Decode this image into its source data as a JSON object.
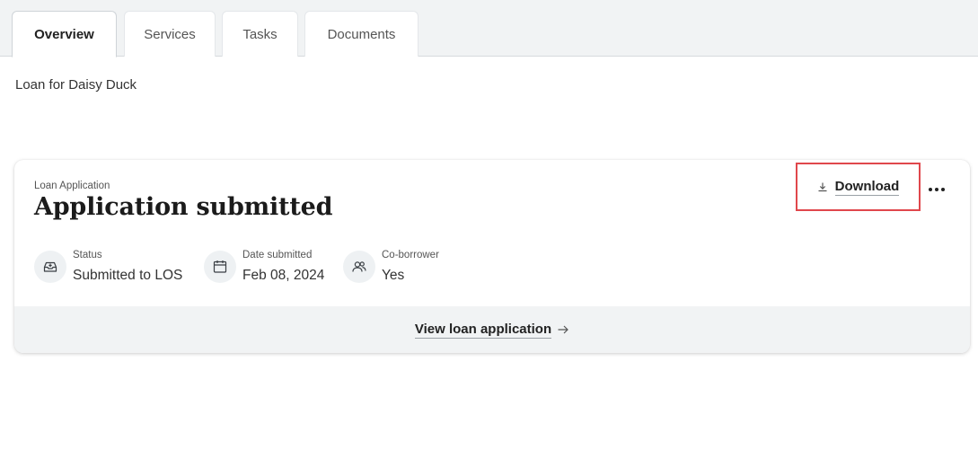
{
  "tabs": [
    {
      "label": "Overview",
      "active": true
    },
    {
      "label": "Services",
      "active": false
    },
    {
      "label": "Tasks",
      "active": false
    },
    {
      "label": "Documents",
      "active": false
    }
  ],
  "page": {
    "subtitle": "Loan for Daisy Duck"
  },
  "card": {
    "eyebrow": "Loan Application",
    "title": "Application submitted",
    "download_label": "Download",
    "download_icon": "download-icon",
    "more_icon": "more-horizontal-icon",
    "highlight_color": "#e0474c",
    "meta": [
      {
        "icon": "inbox-icon",
        "label": "Status",
        "value": "Submitted to LOS"
      },
      {
        "icon": "calendar-icon",
        "label": "Date submitted",
        "value": "Feb 08, 2024"
      },
      {
        "icon": "people-icon",
        "label": "Co-borrower",
        "value": "Yes"
      }
    ],
    "footer_link": "View loan application",
    "footer_icon": "arrow-right-icon"
  }
}
